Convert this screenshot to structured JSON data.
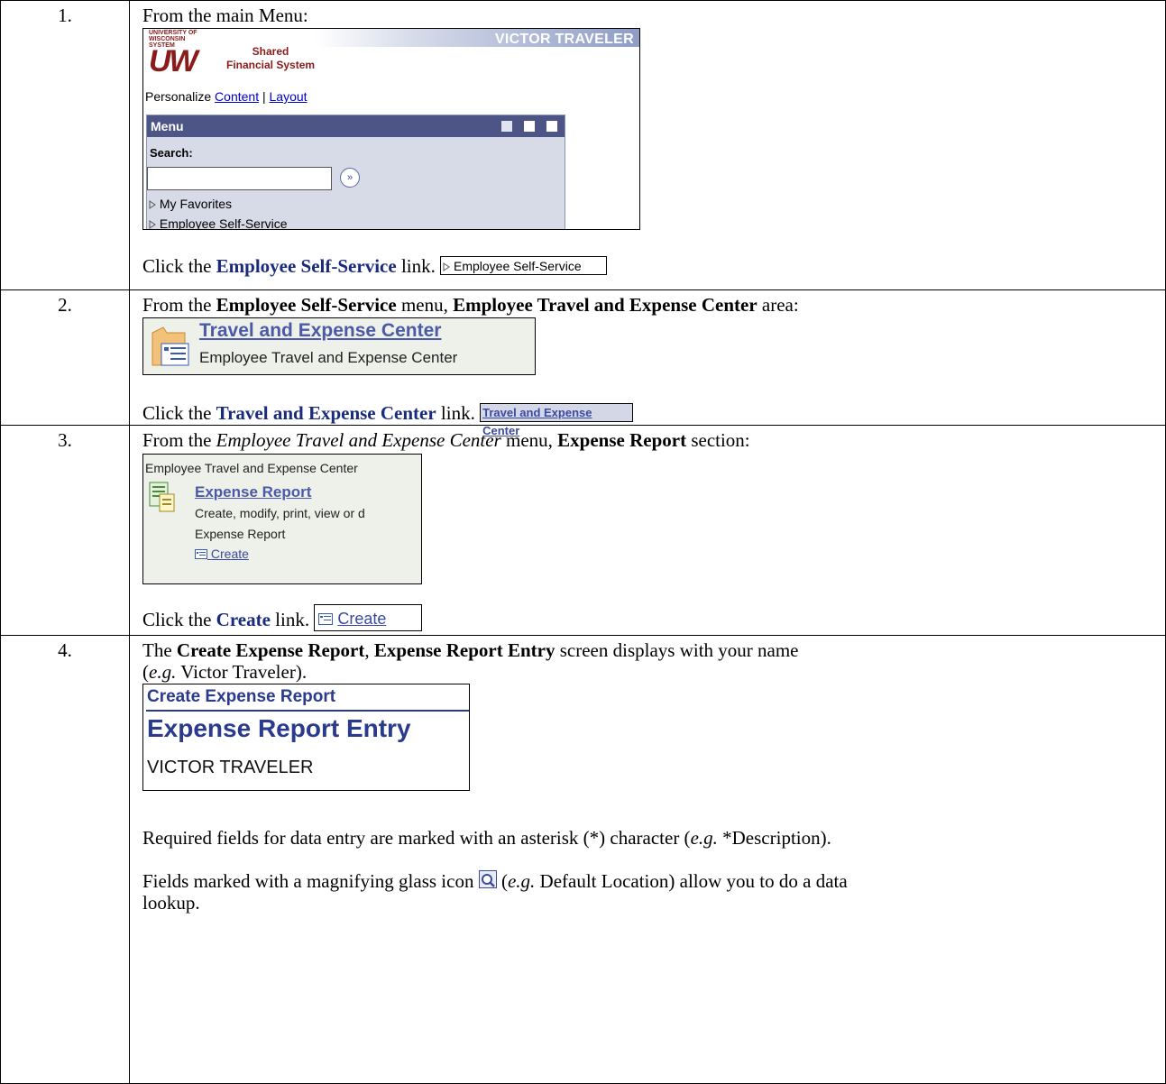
{
  "steps": [
    {
      "number": "1.",
      "intro": "From the main Menu:",
      "screenshot": {
        "logo_university": "UNIVERSITY OF WISCONSIN SYSTEM",
        "logo_mark": "UW",
        "logo_shared": "Shared",
        "logo_financial": "Financial System",
        "banner": "VICTOR TRAVELER",
        "personalize": "Personalize",
        "content_link": "Content",
        "separator": "|",
        "layout_link": "Layout",
        "menu_title": "Menu",
        "search_label": "Search:",
        "search_value": "",
        "go_button": "»",
        "tree_items": [
          "My Favorites",
          "Employee Self-Service"
        ]
      },
      "action_prefix": "Click the",
      "action_target": "Employee Self-Service",
      "action_suffix": "link.",
      "chip": "Employee Self-Service"
    },
    {
      "number": "2.",
      "intro_a": "From the",
      "intro_b": "Employee Self-Service",
      "intro_c": "menu,",
      "intro_d": "Employee Travel and Expense Center",
      "intro_e": "area:",
      "screenshot": {
        "title": "Travel and Expense Center",
        "subtitle": "Employee Travel and Expense Center"
      },
      "action_prefix": "Click the",
      "action_target": "Travel and Expense Center",
      "action_suffix": "link.",
      "chip": "Travel and Expense Center"
    },
    {
      "number": "3.",
      "intro_a": "From the",
      "intro_b": "Employee Travel and Expense Center",
      "intro_c": "menu,",
      "intro_d": "Expense Report",
      "intro_e": "section:",
      "screenshot": {
        "header": "Employee Travel and Expense Center",
        "title": "Expense Report",
        "desc1": "Create, modify, print, view or d",
        "desc2": "Expense Report",
        "create": "Create"
      },
      "action_prefix": "Click the",
      "action_target": "Create",
      "action_suffix": "link.",
      "chip": "Create"
    },
    {
      "number": "4.",
      "intro_a": "The",
      "intro_b": "Create Expense Report",
      "intro_c": ",",
      "intro_d": "Expense Report Entry",
      "intro_e": "screen displays with your name",
      "intro_f": "(",
      "intro_g": "e.g.",
      "intro_h": "Victor Traveler).",
      "screenshot": {
        "heading": "Create Expense Report",
        "title": "Expense Report Entry",
        "name": "VICTOR TRAVELER"
      },
      "required_a": "Required fields for data entry are marked with an asterisk (*) character (",
      "required_eg": "e.g.",
      "required_b": "*Description).",
      "lookup_a": "Fields marked with a magnifying glass icon",
      "lookup_b": "(",
      "lookup_eg": "e.g.",
      "lookup_c": "Default Location) allow you to do a data",
      "lookup_d": "lookup."
    }
  ],
  "icons": {
    "folder": "folder-icon",
    "expense": "expense-report-icon",
    "create": "create-list-icon",
    "magnifier": "magnifying-glass-icon",
    "triangle": "triangle-right-icon"
  }
}
